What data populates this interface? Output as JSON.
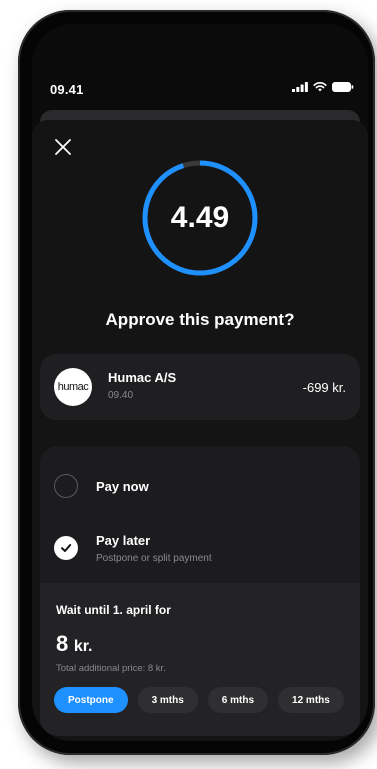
{
  "status_bar": {
    "time": "09.41",
    "icons": [
      "cellular-signal-icon",
      "wifi-icon",
      "battery-icon"
    ]
  },
  "sheet": {
    "close_icon": "close-icon",
    "timer": {
      "value": "4.49",
      "progress": 0.95,
      "ring_color": "#1e90ff",
      "track_color": "#3a3a3c"
    },
    "title": "Approve this payment?"
  },
  "merchant": {
    "logo_text": "humac",
    "name": "Humac A/S",
    "time": "09.40",
    "amount": "-699 kr."
  },
  "options": {
    "pay_now": {
      "label": "Pay now",
      "selected": false
    },
    "pay_later": {
      "label": "Pay later",
      "sublabel": "Postpone or split payment",
      "selected": true
    }
  },
  "wait": {
    "title": "Wait until 1. april for",
    "amount_value": "8",
    "amount_unit": "kr.",
    "total_text": "Total additional price: 8 kr.",
    "chips": [
      {
        "label": "Postpone",
        "active": true
      },
      {
        "label": "3 mths",
        "active": false
      },
      {
        "label": "6 mths",
        "active": false
      },
      {
        "label": "12 mths",
        "active": false
      }
    ]
  },
  "colors": {
    "accent": "#1e90ff",
    "background": "#141414",
    "card": "#1f1f21"
  }
}
